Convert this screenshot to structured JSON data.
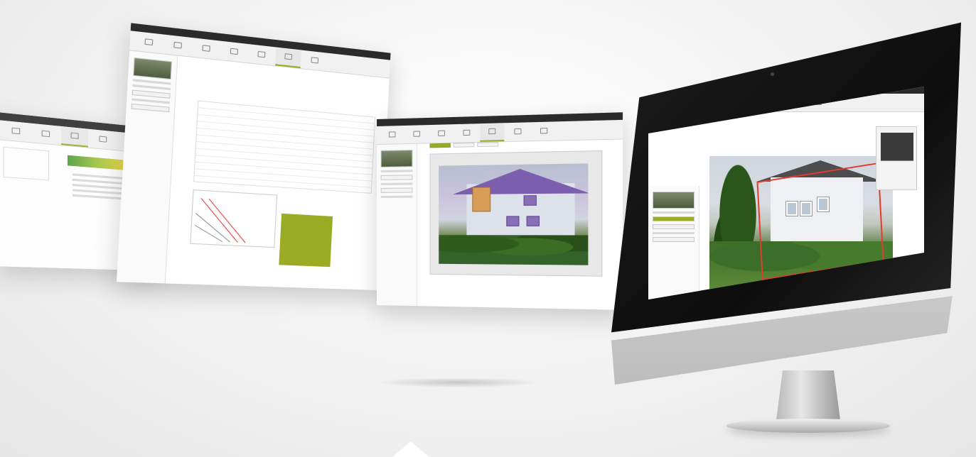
{
  "screens": [
    {
      "id": "s1",
      "titlebar": "",
      "tools": [
        "",
        "",
        "",
        "",
        "",
        "",
        ""
      ]
    },
    {
      "id": "s2",
      "titlebar": "",
      "tools": [
        "",
        "",
        "",
        "",
        "",
        "",
        "",
        "",
        ""
      ]
    },
    {
      "id": "s3",
      "titlebar": "",
      "tools": [
        "",
        "",
        "",
        "",
        "",
        "",
        "",
        ""
      ],
      "tabs": [
        "",
        "",
        ""
      ]
    },
    {
      "id": "imac",
      "titlebar": "",
      "tools": [
        "",
        "",
        "",
        "",
        "",
        "",
        "",
        ""
      ]
    }
  ],
  "colors": {
    "accent": "#9aab24",
    "selection": "#e23c2c",
    "titlebar": "#2b2b2b"
  },
  "icons": [
    "camera-icon",
    "home-icon",
    "roof-icon",
    "tool-icon",
    "chart-icon"
  ]
}
